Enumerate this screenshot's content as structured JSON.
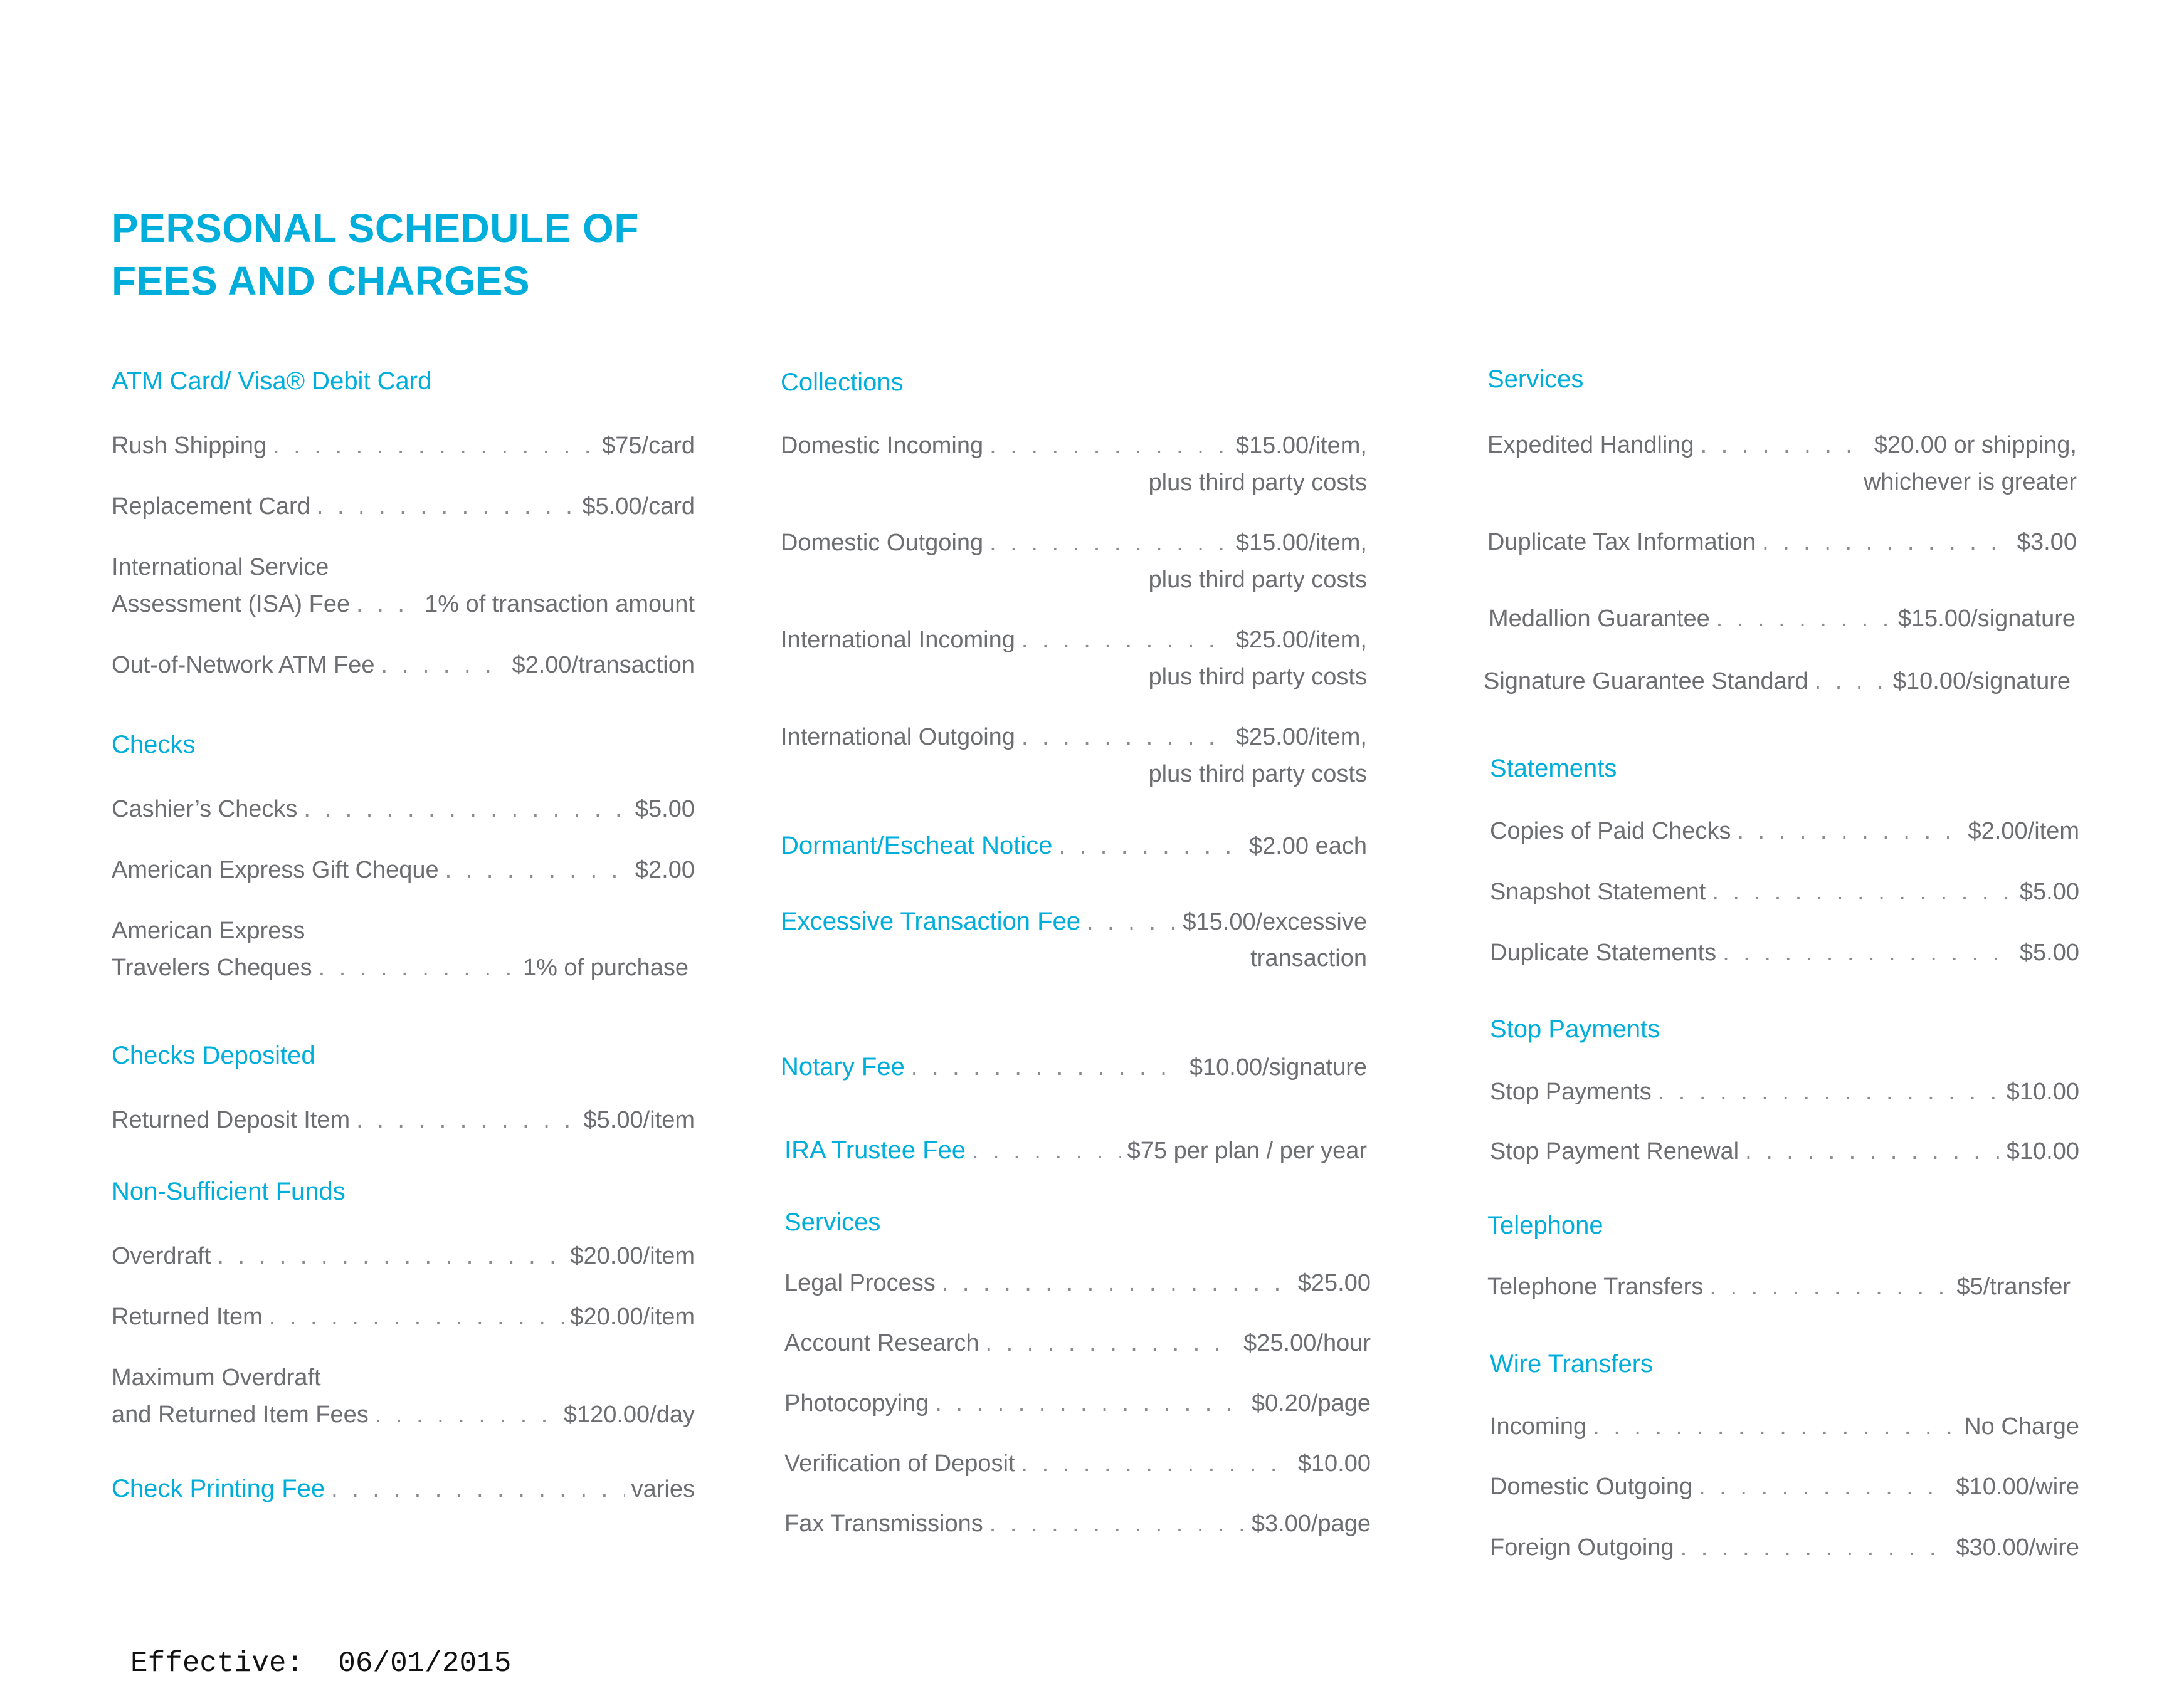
{
  "title": {
    "line1": "PERSONAL SCHEDULE OF",
    "line2": "FEES AND CHARGES"
  },
  "colors": {
    "accent": "#00aedb",
    "body_text": "#6d6e71"
  },
  "col1": {
    "atm": {
      "heading": "ATM Card/ Visa® Debit Card",
      "items": [
        {
          "label": "Rush Shipping",
          "value": "$75/card"
        },
        {
          "label": "Replacement Card",
          "value": "$5.00/card"
        },
        {
          "pre": "International Service",
          "label": "Assessment (ISA) Fee",
          "value": "1% of transaction amount"
        },
        {
          "label": "Out-of-Network ATM Fee",
          "value": "$2.00/transaction"
        }
      ]
    },
    "checks": {
      "heading": "Checks",
      "items": [
        {
          "label": "Cashier’s Checks",
          "value": "$5.00"
        },
        {
          "label": "American Express Gift Cheque",
          "value": "$2.00"
        },
        {
          "pre": "American Express",
          "label": "Travelers Cheques",
          "value": "1% of purchase"
        }
      ]
    },
    "checks_deposited": {
      "heading": "Checks Deposited",
      "items": [
        {
          "label": "Returned Deposit Item",
          "value": "$5.00/item"
        }
      ]
    },
    "nsf": {
      "heading": "Non-Sufficient Funds",
      "items": [
        {
          "label": "Overdraft",
          "value": "$20.00/item"
        },
        {
          "label": "Returned Item",
          "value": "$20.00/item"
        },
        {
          "pre": "Maximum Overdraft",
          "label": "and Returned Item Fees",
          "value": "$120.00/day"
        }
      ]
    },
    "check_printing": {
      "label": "Check Printing Fee",
      "value": "varies"
    }
  },
  "col2": {
    "collections": {
      "heading": "Collections",
      "items": [
        {
          "label": "Domestic Incoming",
          "value": "$15.00/item,",
          "cont": "plus third party costs"
        },
        {
          "label": "Domestic Outgoing",
          "value": "$15.00/item,",
          "cont": "plus third party costs"
        },
        {
          "label": "International Incoming",
          "value": "$25.00/item,",
          "cont": "plus third party costs"
        },
        {
          "label": "International Outgoing",
          "value": "$25.00/item,",
          "cont": "plus third party costs"
        }
      ]
    },
    "dormant": {
      "label": "Dormant/Escheat Notice",
      "value": "$2.00 each"
    },
    "excessive": {
      "label": "Excessive Transaction Fee",
      "value": "$15.00/excessive",
      "cont": "transaction"
    },
    "notary": {
      "label": "Notary Fee",
      "value": "$10.00/signature"
    },
    "ira": {
      "label": "IRA Trustee Fee",
      "value": "$75 per plan / per year"
    },
    "services": {
      "heading": "Services",
      "items": [
        {
          "label": "Legal Process",
          "value": "$25.00"
        },
        {
          "label": "Account Research",
          "value": "$25.00/hour"
        },
        {
          "label": "Photocopying",
          "value": "$0.20/page"
        },
        {
          "label": "Verification of Deposit",
          "value": "$10.00"
        },
        {
          "label": "Fax Transmissions",
          "value": "$3.00/page"
        }
      ]
    }
  },
  "col3": {
    "services": {
      "heading": "Services",
      "items": [
        {
          "label": "Expedited Handling",
          "value": "$20.00 or shipping,",
          "cont": "whichever is greater"
        },
        {
          "label": "Duplicate Tax Information",
          "value": "$3.00"
        },
        {
          "label": "Medallion Guarantee",
          "value": "$15.00/signature"
        },
        {
          "label": "Signature Guarantee Standard",
          "value": "$10.00/signature"
        }
      ]
    },
    "statements": {
      "heading": "Statements",
      "items": [
        {
          "label": "Copies of Paid Checks",
          "value": "$2.00/item"
        },
        {
          "label": "Snapshot Statement",
          "value": "$5.00"
        },
        {
          "label": "Duplicate Statements",
          "value": "$5.00"
        }
      ]
    },
    "stop_payments": {
      "heading": "Stop Payments",
      "items": [
        {
          "label": "Stop Payments",
          "value": "$10.00"
        },
        {
          "label": "Stop Payment Renewal",
          "value": "$10.00"
        }
      ]
    },
    "telephone": {
      "heading": "Telephone",
      "items": [
        {
          "label": "Telephone Transfers",
          "value": "$5/transfer"
        }
      ]
    },
    "wire": {
      "heading": "Wire Transfers",
      "items": [
        {
          "label": "Incoming",
          "value": "No Charge"
        },
        {
          "label": "Domestic Outgoing",
          "value": "$10.00/wire"
        },
        {
          "label": "Foreign Outgoing",
          "value": "$30.00/wire"
        }
      ]
    }
  },
  "footer": {
    "effective_label": "Effective:",
    "effective_date": "06/01/2015"
  }
}
